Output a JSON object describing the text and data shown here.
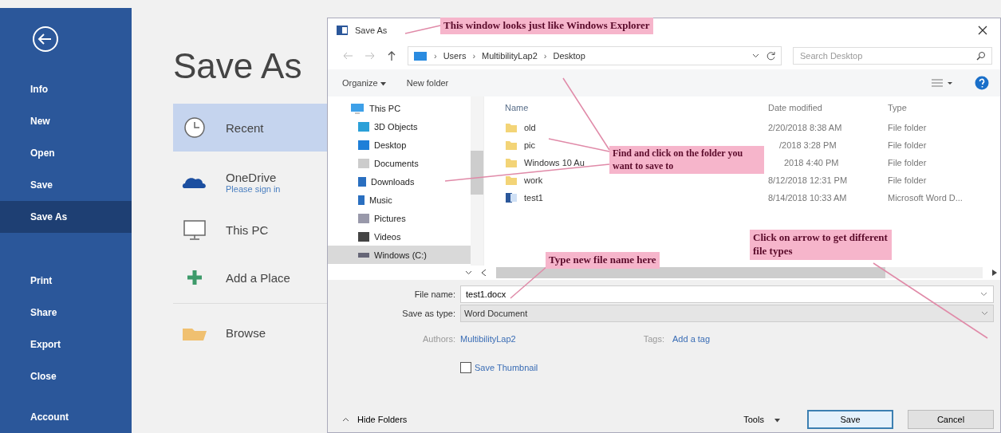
{
  "backstage": {
    "menu": [
      {
        "label": "Info",
        "selected": false
      },
      {
        "label": "New",
        "selected": false
      },
      {
        "label": "Open",
        "selected": false
      },
      {
        "label": "Save",
        "selected": false
      },
      {
        "label": "Save As",
        "selected": true
      },
      {
        "label": "Print",
        "selected": false
      },
      {
        "label": "Share",
        "selected": false
      },
      {
        "label": "Export",
        "selected": false
      },
      {
        "label": "Close",
        "selected": false
      },
      {
        "label": "Account",
        "selected": false
      }
    ],
    "heading": "Save As",
    "places": [
      {
        "label": "Recent",
        "selected": true
      },
      {
        "label": "OneDrive",
        "sublabel": "Please sign in",
        "selected": false
      },
      {
        "label": "This PC",
        "selected": false
      },
      {
        "label": "Add a Place",
        "selected": false
      },
      {
        "label": "Browse",
        "selected": false
      }
    ]
  },
  "dialog": {
    "title": "Save As",
    "path": {
      "items": [
        "Users",
        "MultibilityLap2",
        "Desktop"
      ],
      "separator": "›"
    },
    "search": {
      "placeholder": "Search Desktop"
    },
    "toolbar": {
      "organize": "Organize",
      "new_folder": "New folder"
    },
    "nav": [
      {
        "label": "This PC",
        "selected": false,
        "children": [
          {
            "label": "3D Objects",
            "selected": false
          },
          {
            "label": "Desktop",
            "selected": false
          },
          {
            "label": "Documents",
            "selected": false
          },
          {
            "label": "Downloads",
            "selected": false
          },
          {
            "label": "Music",
            "selected": false
          },
          {
            "label": "Pictures",
            "selected": false
          },
          {
            "label": "Videos",
            "selected": false
          },
          {
            "label": "Windows (C:)",
            "selected": true
          }
        ]
      }
    ],
    "columns": [
      "Name",
      "Date modified",
      "Type"
    ],
    "rows": [
      {
        "kind": "folder",
        "name": "old",
        "date": "2/20/2018 8:38 AM",
        "type": "File folder"
      },
      {
        "kind": "folder",
        "name": "pic",
        "date": "/2018 3:28 PM",
        "type": "File folder"
      },
      {
        "kind": "folder",
        "name": "Windows 10 Au",
        "date": "2018 4:40 PM",
        "type": "File folder"
      },
      {
        "kind": "folder",
        "name": "work",
        "date": "8/12/2018 12:31 PM",
        "type": "File folder"
      },
      {
        "kind": "document",
        "name": "test1",
        "date": "8/14/2018 10:33 AM",
        "type": "Microsoft Word D..."
      }
    ],
    "file_name": {
      "label": "File name:",
      "value": "test1.docx"
    },
    "save_type": {
      "label": "Save as type:",
      "value": "Word Document"
    },
    "authors": {
      "label": "Authors:",
      "value": "MultibilityLap2"
    },
    "tags": {
      "label": "Tags:",
      "value": "Add a tag"
    },
    "thumbnail": {
      "label": "Save Thumbnail",
      "checked": false
    },
    "hide_folders": "Hide Folders",
    "tools": "Tools",
    "buttons": [
      "Save",
      "Cancel"
    ]
  },
  "callouts": [
    "This window looks just like Windows Explorer",
    "Find and click on the folder you want to save to",
    "Type new file name here",
    "Click on arrow to get different file types"
  ]
}
